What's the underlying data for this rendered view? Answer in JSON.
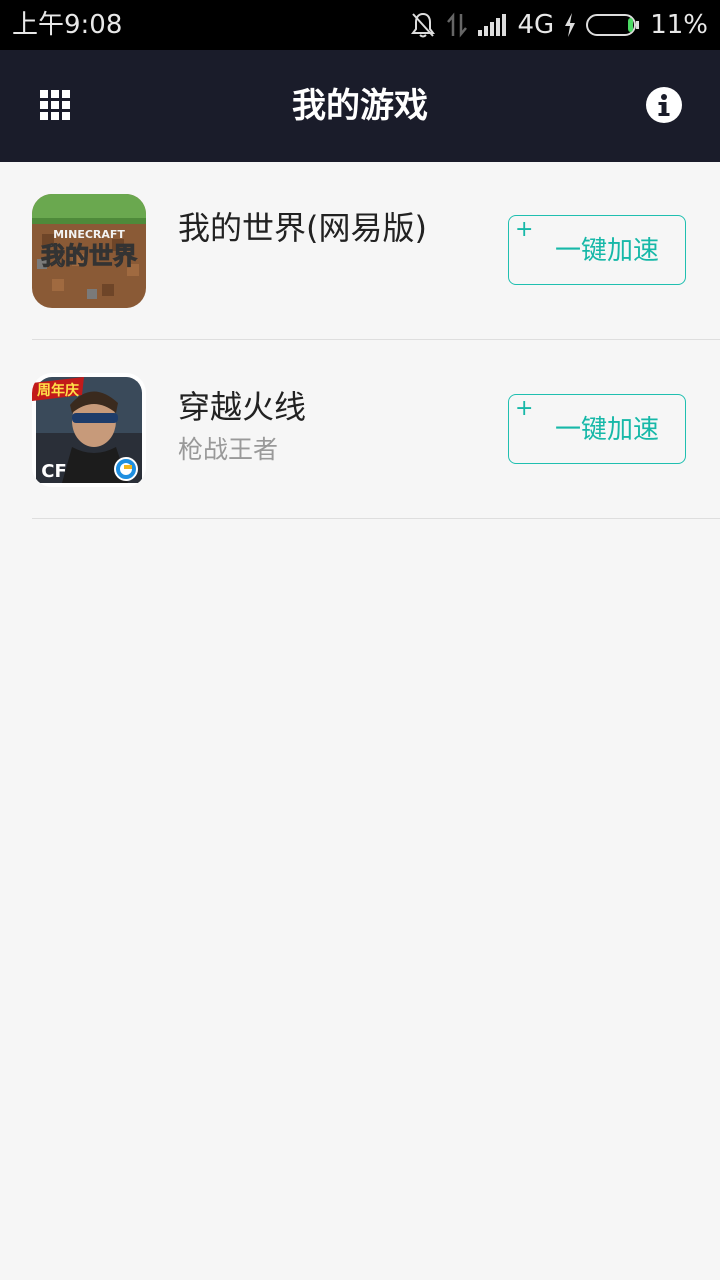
{
  "status_bar": {
    "time": "上午9:08",
    "network": "4G",
    "battery_percent": "11%",
    "battery_level": 0.11,
    "icons": [
      "bell-off-icon",
      "data-arrows-icon",
      "signal-icon",
      "charging-icon",
      "battery-icon"
    ]
  },
  "header": {
    "title": "我的游戏",
    "left_icon": "grid-menu-icon",
    "right_icon": "info-icon"
  },
  "games": [
    {
      "name": "我的世界(网易版)",
      "subtitle": "",
      "button_label": "一键加速",
      "button_icon": "+",
      "icon_text": "我的世界",
      "icon_subtext": "MINECRAFT"
    },
    {
      "name": "穿越火线",
      "subtitle": "枪战王者",
      "button_label": "一键加速",
      "button_icon": "+",
      "icon_badge": "周年庆",
      "icon_logo": "CF"
    }
  ],
  "colors": {
    "header_bg": "#1a1c2a",
    "accent": "#1fbfb0",
    "page_bg": "#f6f6f6"
  }
}
